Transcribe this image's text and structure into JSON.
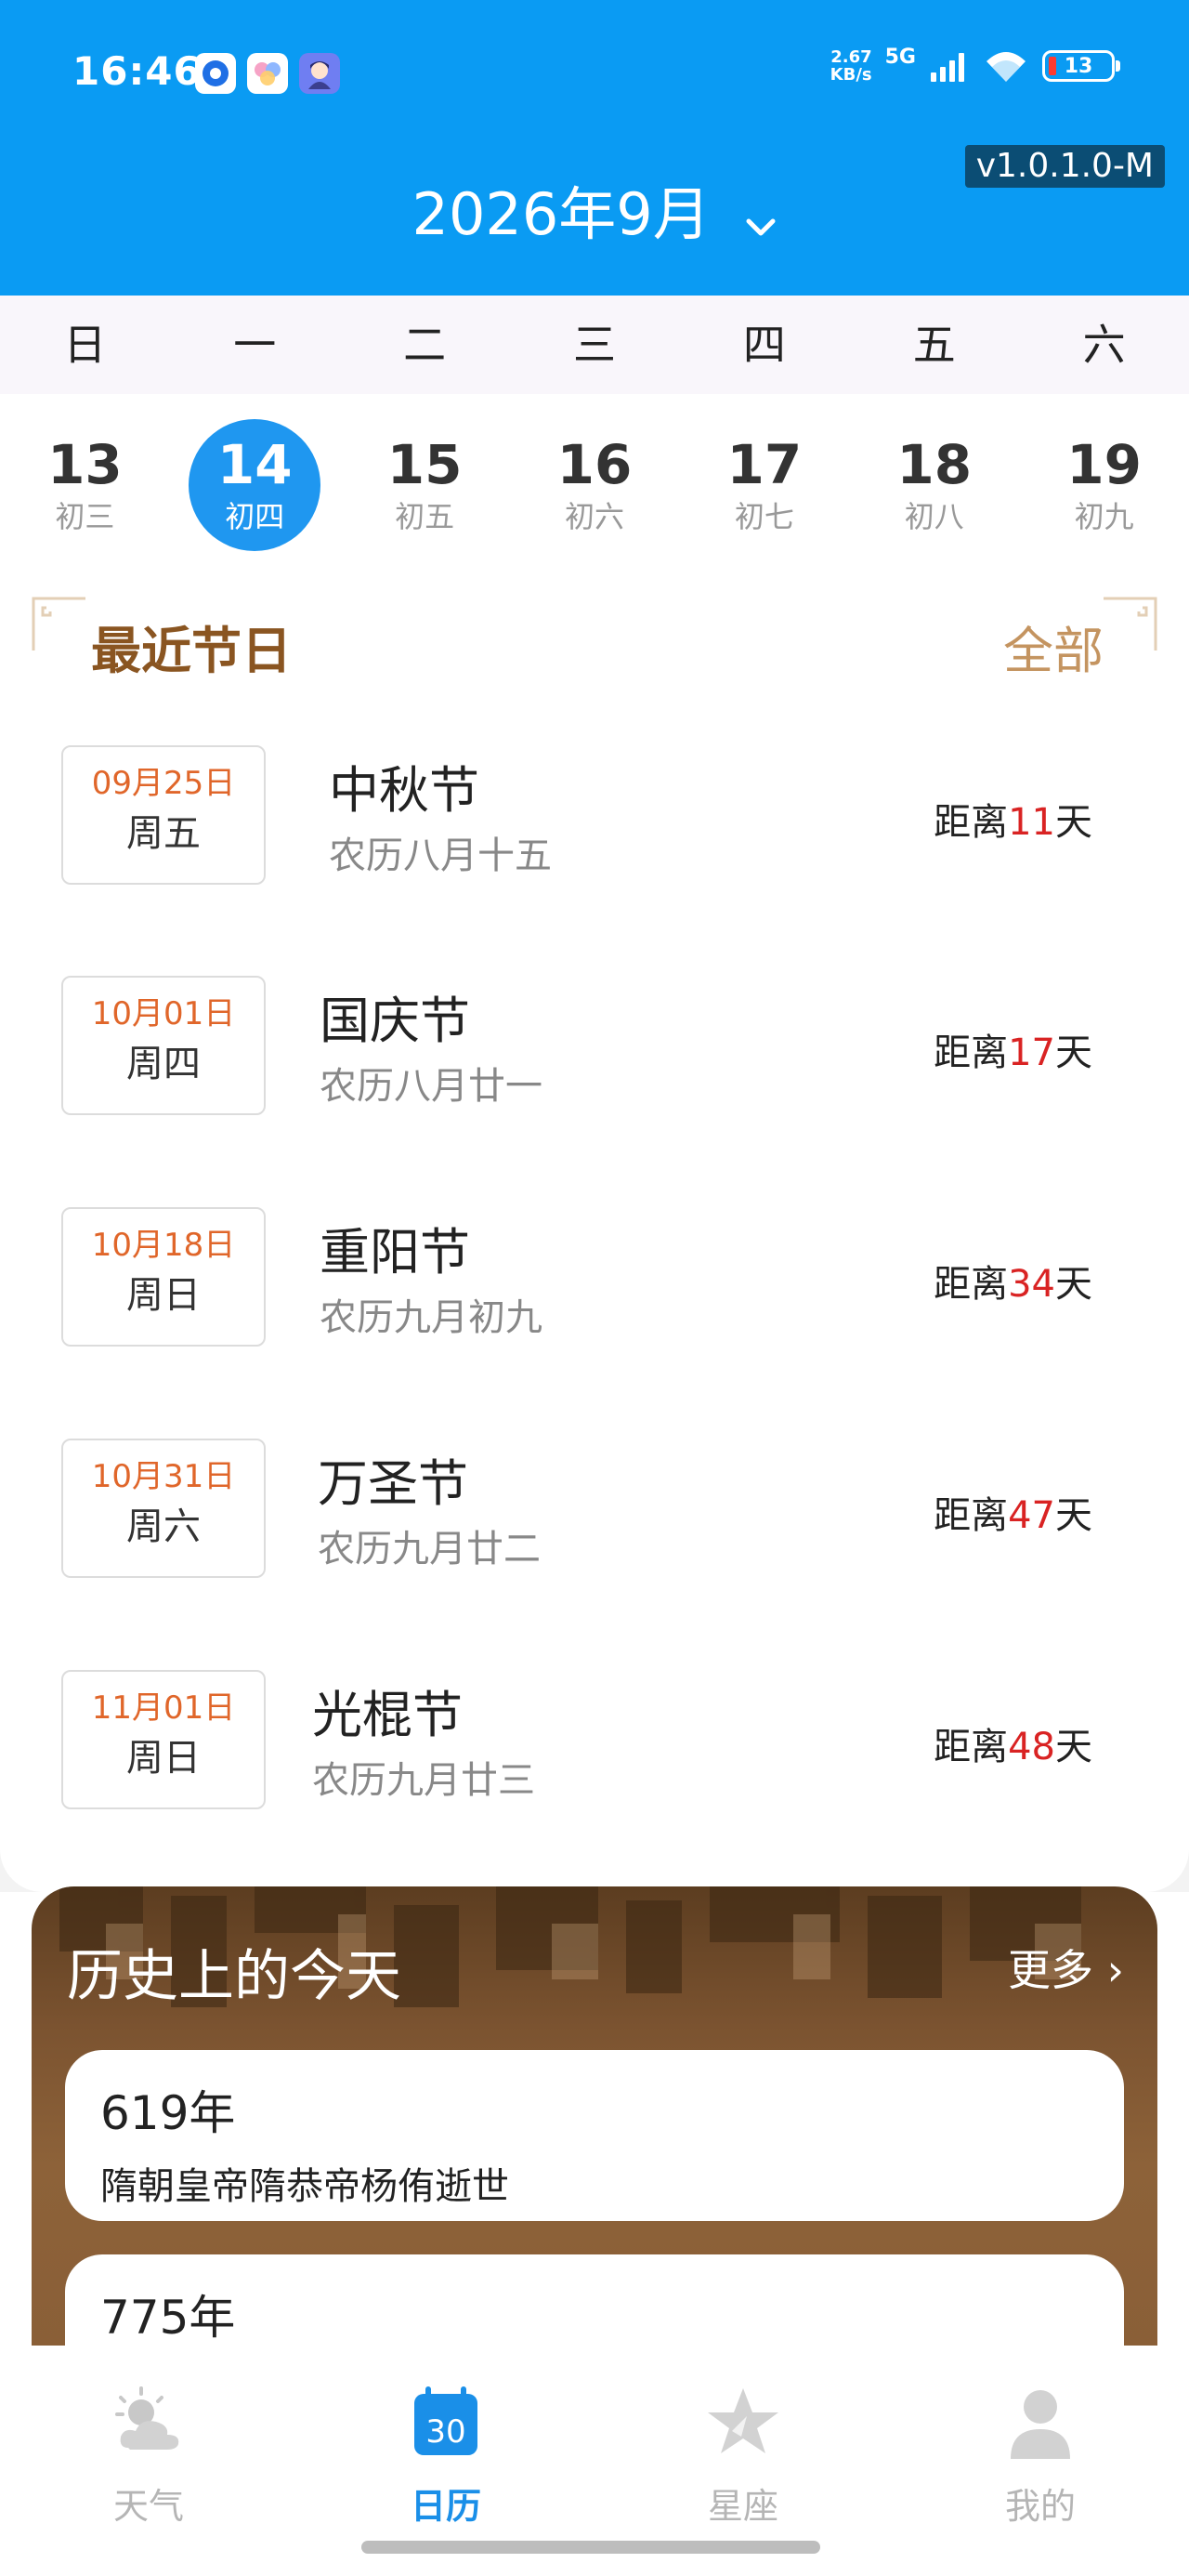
{
  "status_bar": {
    "time": "16:46",
    "net_speed_value": "2.67",
    "net_speed_unit": "KB/s",
    "network": "5G",
    "battery": "13",
    "icons": [
      "blue-app-icon",
      "flower-app-icon",
      "avatar-app-icon",
      "signal-icon",
      "wifi-icon",
      "battery-icon"
    ]
  },
  "header": {
    "version": "v1.0.1.0-M",
    "month_title": "2026年9月",
    "bg_color": "#0a9bf3"
  },
  "calendar": {
    "weekdays": [
      "日",
      "一",
      "二",
      "三",
      "四",
      "五",
      "六"
    ],
    "days": [
      {
        "num": "13",
        "lunar": "初三"
      },
      {
        "num": "14",
        "lunar": "初四",
        "selected": true
      },
      {
        "num": "15",
        "lunar": "初五"
      },
      {
        "num": "16",
        "lunar": "初六"
      },
      {
        "num": "17",
        "lunar": "初七"
      },
      {
        "num": "18",
        "lunar": "初八"
      },
      {
        "num": "19",
        "lunar": "初九"
      }
    ]
  },
  "festivals": {
    "title": "最近节日",
    "all_label": "全部",
    "count_prefix": "距离",
    "count_suffix": "天",
    "items": [
      {
        "date": "09月25日",
        "weekday": "周五",
        "name": "中秋节",
        "lunar": "农历八月十五",
        "days": "11"
      },
      {
        "date": "10月01日",
        "weekday": "周四",
        "name": "国庆节",
        "lunar": "农历八月廿一",
        "days": "17"
      },
      {
        "date": "10月18日",
        "weekday": "周日",
        "name": "重阳节",
        "lunar": "农历九月初九",
        "days": "34"
      },
      {
        "date": "10月31日",
        "weekday": "周六",
        "name": "万圣节",
        "lunar": "农历九月廿二",
        "days": "47"
      },
      {
        "date": "11月01日",
        "weekday": "周日",
        "name": "光棍节",
        "lunar": "农历九月廿三",
        "days": "48"
      }
    ]
  },
  "history": {
    "title": "历史上的今天",
    "more_label": "更多 ›",
    "items": [
      {
        "year": "619年",
        "text": "隋朝皇帝隋恭帝杨侑逝世"
      },
      {
        "year": "775年",
        "text": ""
      }
    ]
  },
  "tabbar": {
    "tabs": [
      {
        "label": "天气",
        "icon": "weather-icon"
      },
      {
        "label": "日历",
        "icon": "calendar-icon",
        "active": true,
        "icon_text": "30"
      },
      {
        "label": "星座",
        "icon": "star-icon"
      },
      {
        "label": "我的",
        "icon": "person-icon"
      }
    ],
    "active_color": "#1a8fe8"
  }
}
